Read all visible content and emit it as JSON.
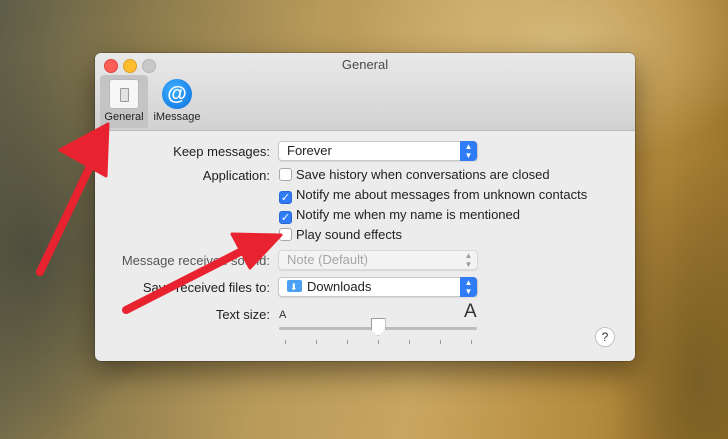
{
  "window": {
    "title": "General",
    "tabs": [
      {
        "label": "General",
        "selected": true,
        "icon": "general-switch-icon"
      },
      {
        "label": "iMessage",
        "selected": false,
        "icon": "at-sign-icon"
      }
    ]
  },
  "settings": {
    "keep_messages": {
      "label": "Keep messages:",
      "value": "Forever"
    },
    "application": {
      "label": "Application:",
      "options": [
        {
          "label": "Save history when conversations are closed",
          "checked": false
        },
        {
          "label": "Notify me about messages from unknown contacts",
          "checked": true
        },
        {
          "label": "Notify me when my name is mentioned",
          "checked": true
        },
        {
          "label": "Play sound effects",
          "checked": false
        }
      ]
    },
    "message_received_sound": {
      "label": "Message received sound:",
      "value": "Note (Default)",
      "enabled": false
    },
    "save_received_files": {
      "label": "Save received files to:",
      "value": "Downloads"
    },
    "text_size": {
      "label": "Text size:",
      "small_marker": "A",
      "large_marker": "A",
      "level": 0.5
    },
    "help_label": "?"
  },
  "colors": {
    "accent": "#2f7cf6",
    "annotation_arrow": "#e8232f"
  }
}
